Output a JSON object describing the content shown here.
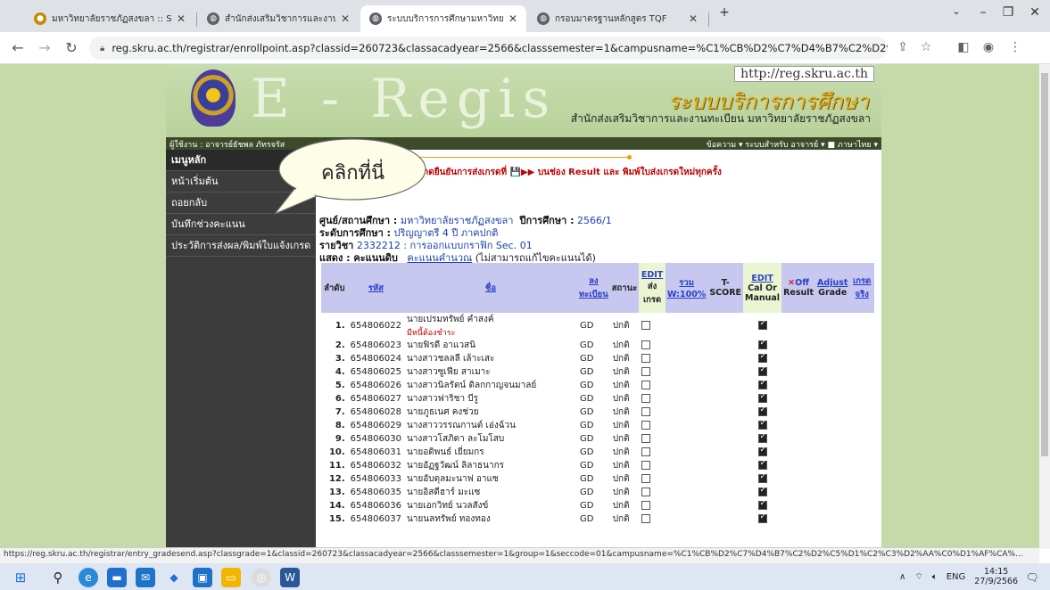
{
  "browser": {
    "tabs": [
      {
        "label": "มหาวิทยาลัยราชภัฏสงขลา :: Songkh",
        "color": "#c48a00"
      },
      {
        "label": "สำนักส่งเสริมวิชาการและงานทะเบียน",
        "color": "#5f6368"
      },
      {
        "label": "ระบบบริการการศึกษามหาวิทยาลัยราช",
        "color": "#5f6368"
      },
      {
        "label": "กรอบมาตรฐานหลักสูตร TQF",
        "color": "#5f6368"
      }
    ],
    "new_tab": "+",
    "url": "reg.skru.ac.th/registrar/enrollpoint.asp?classid=260723&classacadyear=2566&classsemester=1&campusname=%C1%CB%D2%C7%D4%B7%C2%D2%C5%D1%C2%C3%..."
  },
  "site": {
    "url_box": "http://reg.skru.ac.th",
    "big_letters": "E - Regis",
    "title_th": "ระบบบริการการศึกษา",
    "subtitle_th": "สำนักส่งเสริมวิชาการและงานทะเบียน  มหาวิทยาลัยราชภัฏสงขลา",
    "user": "ผู้ใช้งาน : อาจารย์ธัชพล ภัทรจรัส",
    "menus": "ข้อความ ▾  ระบบสำหรับ อาจารย์ ▾  ■ ภาษาไทย ▾"
  },
  "sidebar": {
    "items": [
      {
        "label": "เมนูหลัก"
      },
      {
        "label": "หน้าเริ่มต้น"
      },
      {
        "label": "ถอยกลับ"
      },
      {
        "label": "บันทึกช่วงคะแนน"
      },
      {
        "label": "ประวัติการส่งผล/พิมพ์ใบแจ้งเกรด"
      }
    ]
  },
  "content": {
    "warning": "น/เกรดกรุณากดยืนยันการส่งเกรดที่ 💾▶▶ บนช่อง Result และ พิมพ์ใบส่งเกรดใหม่ทุกครั้ง",
    "center_label": "ศูนย์/สถานศึกษา :",
    "center_value": "มหาวิทยาลัยราชภัฏสงขลา",
    "year_label": "ปีการศึกษา :",
    "year_value": "2566/1",
    "level_label": "ระดับการศึกษา :",
    "level_value": "ปริญญาตรี 4 ปี ภาคปกติ",
    "course_label": "รายวิชา",
    "course_value": "2332212 : การออกแบบกราฟิก",
    "sec": "Sec.  01",
    "show_label": "แสดง : คะแนนดิบ",
    "show_link": "คะแนนคำนวณ",
    "show_note": "(ไม่สามารถแก้ไขคะแนนได้)"
  },
  "table": {
    "headers": {
      "order": "ลำดับ",
      "id": "รหัส",
      "name": "ชื่อ",
      "reg": "ลง ทะเบียน",
      "status": "สถานะ",
      "send_edit": "EDIT",
      "send": "ส่ง เกรด",
      "total": "รวม W:100%",
      "tscore": "T- SCORE",
      "cal_edit": "EDIT",
      "cal": "Cal Or Manual",
      "result_off": "Off",
      "result": "Result",
      "adjust": "Adjust",
      "grade": "Grade",
      "real": "เกรด จริง"
    },
    "rows": [
      {
        "n": "1.",
        "id": "654806022",
        "name": "นายเปรมทรัพย์ คำสงค์",
        "note": "มีหนี้ต้องชำระ",
        "reg": "GD",
        "status": "ปกติ"
      },
      {
        "n": "2.",
        "id": "654806023",
        "name": "นายฟิรดี อาแวสนิ",
        "note": "",
        "reg": "GD",
        "status": "ปกติ"
      },
      {
        "n": "3.",
        "id": "654806024",
        "name": "นางสาวชลลลี เล้าะเสะ",
        "note": "",
        "reg": "GD",
        "status": "ปกติ"
      },
      {
        "n": "4.",
        "id": "654806025",
        "name": "นางสาวซูเฟีย สาเมาะ",
        "note": "",
        "reg": "GD",
        "status": "ปกติ"
      },
      {
        "n": "5.",
        "id": "654806026",
        "name": "นางสาวนิลรัตน์ ดิลกกาญจนมาลย์",
        "note": "",
        "reg": "GD",
        "status": "ปกติ"
      },
      {
        "n": "6.",
        "id": "654806027",
        "name": "นางสาวฟาริชา บีรู",
        "note": "",
        "reg": "GD",
        "status": "ปกติ"
      },
      {
        "n": "7.",
        "id": "654806028",
        "name": "นายภูธเนศ คงช่วย",
        "note": "",
        "reg": "GD",
        "status": "ปกติ"
      },
      {
        "n": "8.",
        "id": "654806029",
        "name": "นางสาววรรณกานต์ เอ่งฉ้วน",
        "note": "",
        "reg": "GD",
        "status": "ปกติ"
      },
      {
        "n": "9.",
        "id": "654806030",
        "name": "นางสาวโสภิดา ละโมโสบ",
        "note": "",
        "reg": "GD",
        "status": "ปกติ"
      },
      {
        "n": "10.",
        "id": "654806031",
        "name": "นายอดิพนธ์ เยี่ยมกร",
        "note": "",
        "reg": "GD",
        "status": "ปกติ"
      },
      {
        "n": "11.",
        "id": "654806032",
        "name": "นายอัฏฐวัฒน์ ลิลาธนากร",
        "note": "",
        "reg": "GD",
        "status": "ปกติ"
      },
      {
        "n": "12.",
        "id": "654806033",
        "name": "นายอับดุลมะนาฟ อาแซ",
        "note": "",
        "reg": "GD",
        "status": "ปกติ"
      },
      {
        "n": "13.",
        "id": "654806035",
        "name": "นายอิสดีฮาร์ มะแซ",
        "note": "",
        "reg": "GD",
        "status": "ปกติ"
      },
      {
        "n": "14.",
        "id": "654806036",
        "name": "นายเอกวิทย์ นวลสังข์",
        "note": "",
        "reg": "GD",
        "status": "ปกติ"
      },
      {
        "n": "15.",
        "id": "654806037",
        "name": "นายนลทรัพย์ ทองทอง",
        "note": "",
        "reg": "GD",
        "status": "ปกติ"
      }
    ]
  },
  "callout": {
    "text": "คลิกที่นี่"
  },
  "status_url": "https://reg.skru.ac.th/registrar/entry_gradesend.asp?classgrade=1&classid=260723&classacadyear=2566&classsemester=1&group=1&seccode=01&campusname=%C1%CB%D2%C7%D4%B7%C2%D2%C5%D1%C2%C3%D2%AA%C0%D1%AF%CA%...",
  "taskbar": {
    "lang": "ENG",
    "time": "14:15",
    "date": "27/9/2566"
  }
}
